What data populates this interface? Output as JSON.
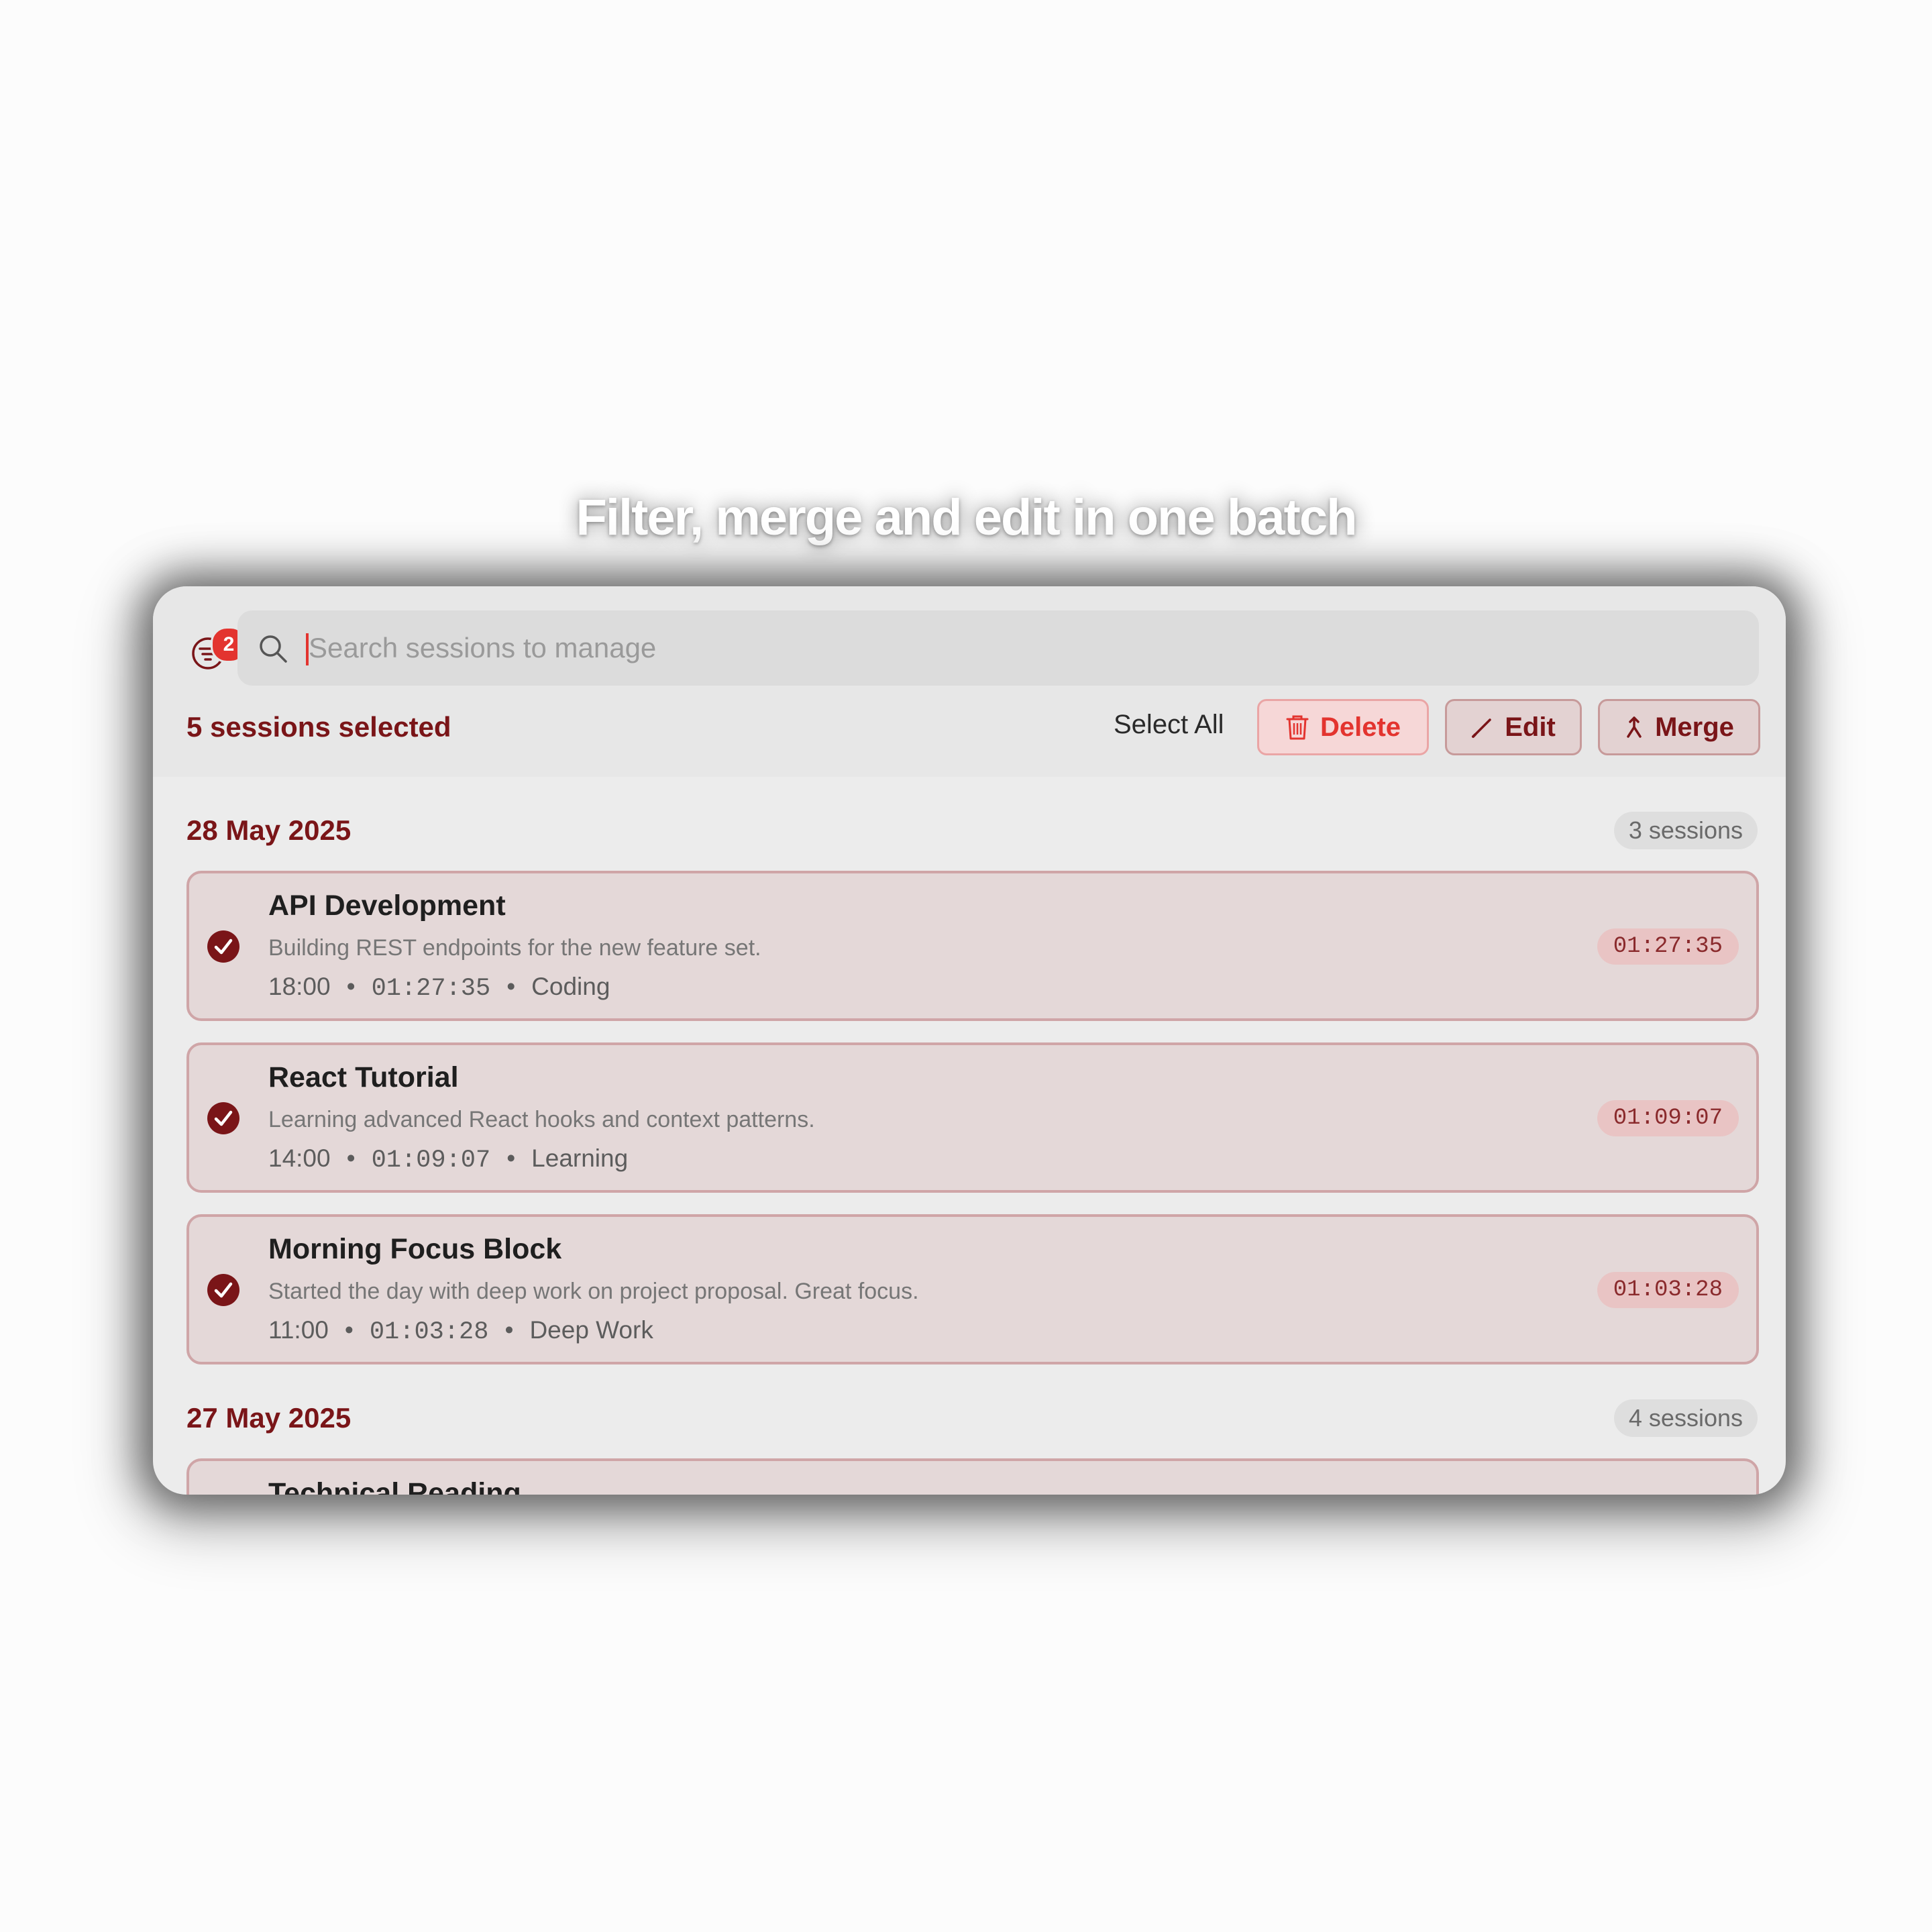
{
  "headline": "Filter, merge and edit in one batch",
  "filter": {
    "badge_count": "2"
  },
  "search": {
    "placeholder": "Search sessions to manage",
    "value": ""
  },
  "selection": {
    "count_label": "5 sessions selected",
    "select_all_label": "Select All"
  },
  "actions": {
    "delete_label": "Delete",
    "edit_label": "Edit",
    "merge_label": "Merge"
  },
  "colors": {
    "accent": "#7a1518",
    "danger": "#e3342f",
    "card_bg": "#e4d8d8",
    "card_border": "#cfa5a7"
  },
  "groups": [
    {
      "date": "28 May 2025",
      "count": "3 sessions",
      "sessions": [
        {
          "title": "API Development",
          "description": "Building REST endpoints for the new feature set.",
          "start": "18:00",
          "duration": "01:27:35",
          "category": "Coding",
          "badge": "01:27:35"
        },
        {
          "title": "React Tutorial",
          "description": "Learning advanced React hooks and context patterns.",
          "start": "14:00",
          "duration": "01:09:07",
          "category": "Learning",
          "badge": "01:09:07"
        },
        {
          "title": "Morning Focus Block",
          "description": "Started the day with deep work on project proposal. Great focus.",
          "start": "11:00",
          "duration": "01:03:28",
          "category": "Deep Work",
          "badge": "01:03:28"
        }
      ]
    },
    {
      "date": "27 May 2025",
      "count": "4 sessions",
      "sessions": [
        {
          "title": "Technical Reading"
        }
      ]
    }
  ]
}
